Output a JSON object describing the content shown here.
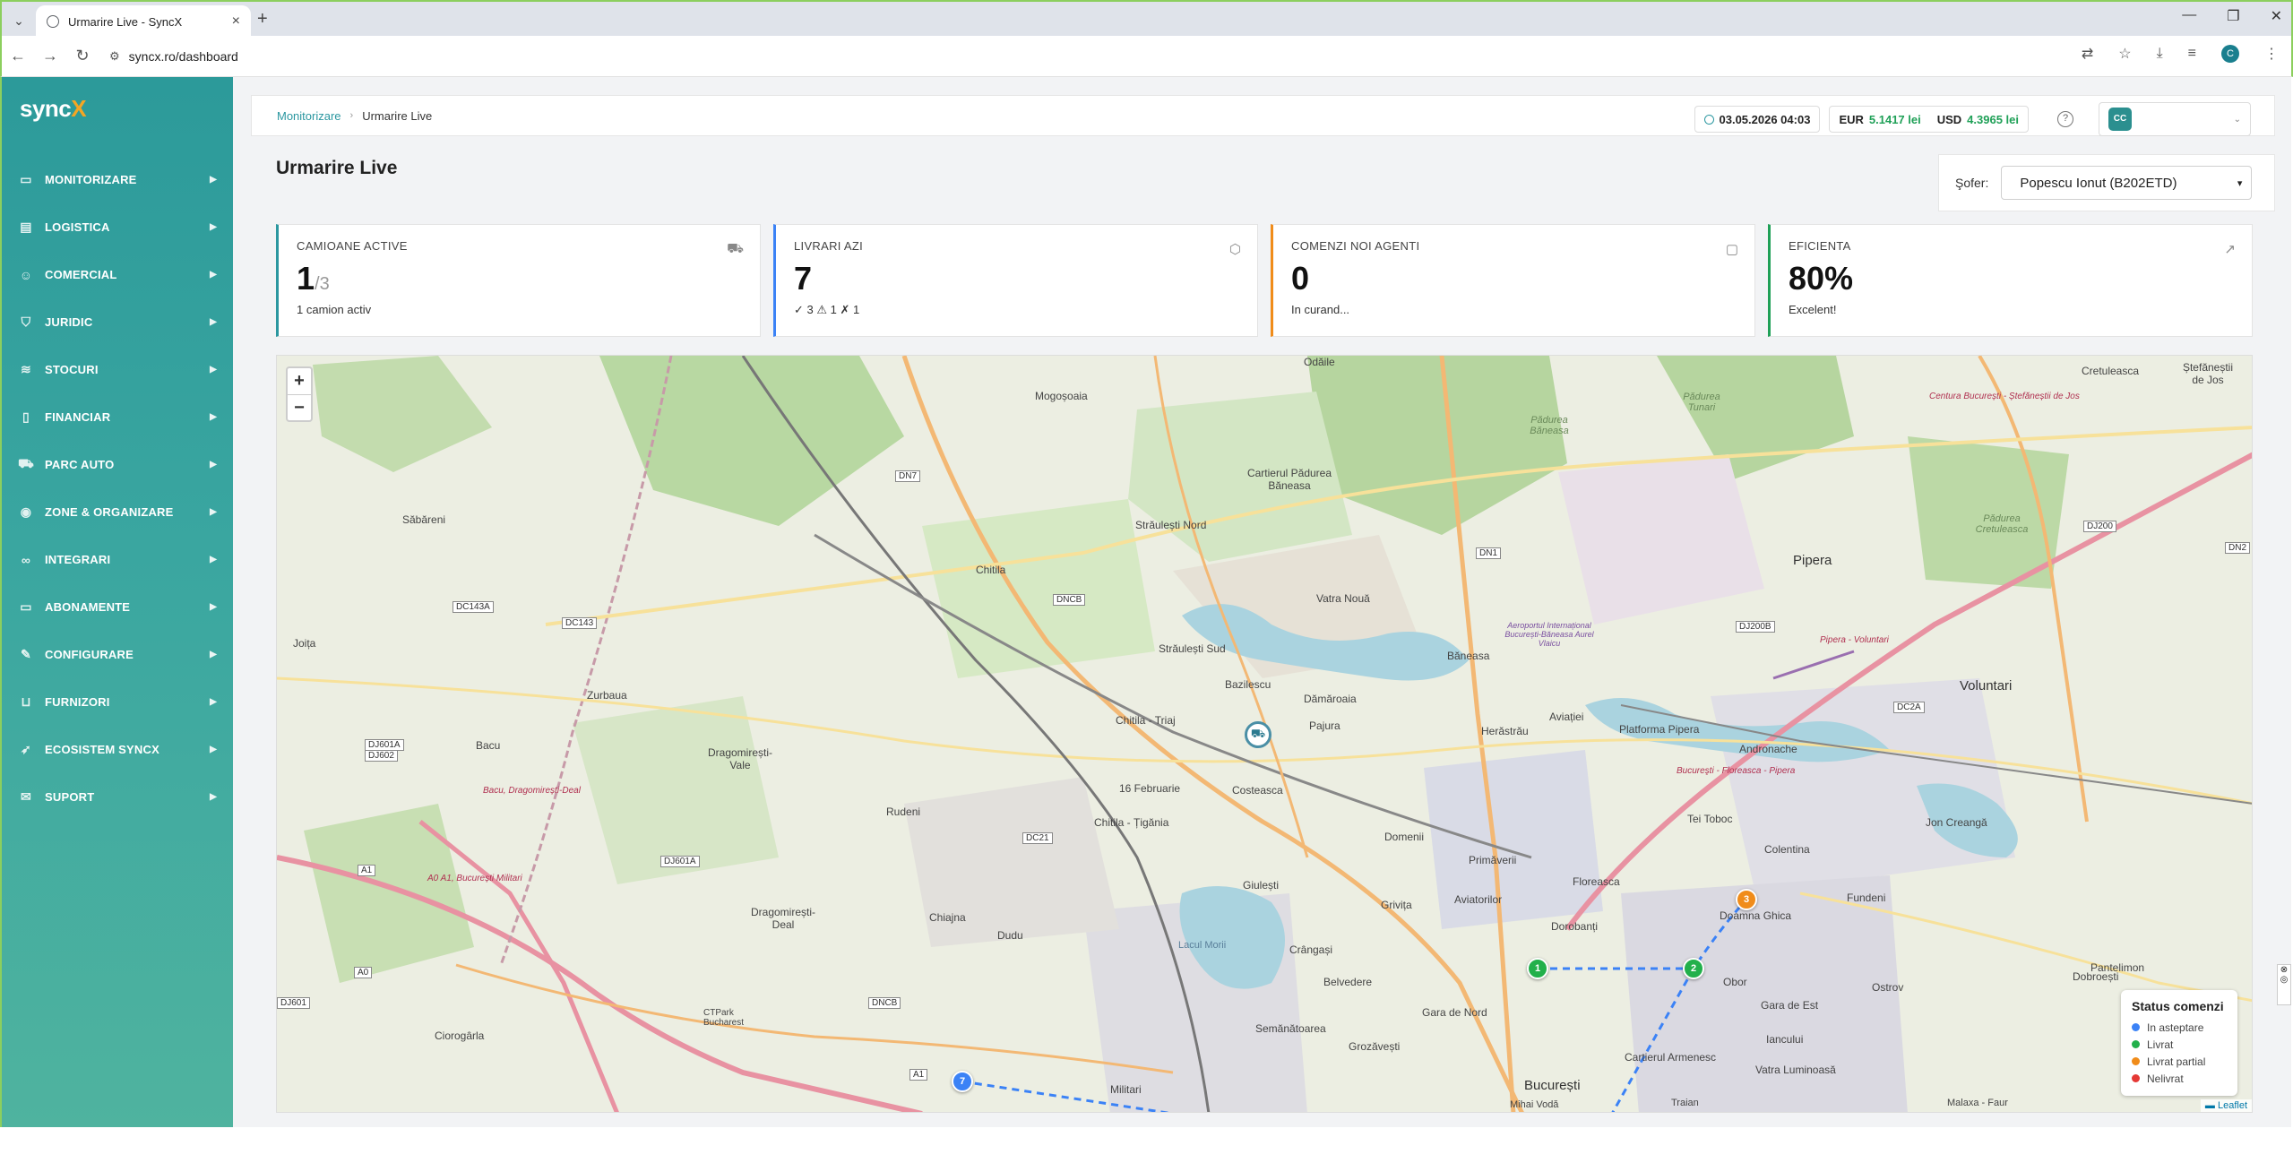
{
  "browser": {
    "tab_title": "Urmarire Live - SyncX",
    "url": "syncx.ro/dashboard",
    "profile_initial": "C"
  },
  "brand": {
    "logo_main": "sync",
    "logo_x": "X"
  },
  "sidebar": {
    "items": [
      {
        "label": "MONITORIZARE",
        "icon": "monitor-icon"
      },
      {
        "label": "LOGISTICA",
        "icon": "clipboard-icon"
      },
      {
        "label": "COMERCIAL",
        "icon": "users-icon"
      },
      {
        "label": "JURIDIC",
        "icon": "shield-icon"
      },
      {
        "label": "STOCURI",
        "icon": "layers-icon"
      },
      {
        "label": "FINANCIAR",
        "icon": "document-icon"
      },
      {
        "label": "PARC AUTO",
        "icon": "truck-icon"
      },
      {
        "label": "ZONE & ORGANIZARE",
        "icon": "map-pin-icon"
      },
      {
        "label": "INTEGRARI",
        "icon": "link-icon"
      },
      {
        "label": "ABONAMENTE",
        "icon": "credit-card-icon"
      },
      {
        "label": "CONFIGURARE",
        "icon": "wrench-icon"
      },
      {
        "label": "FURNIZORI",
        "icon": "cart-icon"
      },
      {
        "label": "ECOSISTEM SYNCX",
        "icon": "rocket-icon"
      },
      {
        "label": "SUPORT",
        "icon": "mail-icon"
      }
    ]
  },
  "header": {
    "breadcrumb_root": "Monitorizare",
    "breadcrumb_current": "Urmarire Live",
    "datetime": "03.05.2026 04:03",
    "eur_label": "EUR",
    "eur_value": "5.1417 lei",
    "usd_label": "USD",
    "usd_value": "4.3965 lei",
    "user_initials": "CC"
  },
  "page": {
    "title": "Urmarire Live",
    "driver_label": "Şofer:",
    "driver_value": "Popescu Ionut (B202ETD)"
  },
  "cards": [
    {
      "title": "CAMIOANE ACTIVE",
      "value": "1",
      "value_sub": "/3",
      "foot": "1 camion activ",
      "accent": "#2b97a0",
      "icon": "truck-icon"
    },
    {
      "title": "LIVRARI AZI",
      "value": "7",
      "value_sub": "",
      "foot": "✓ 3   ⚠ 1   ✗ 1",
      "accent": "#3b82f6",
      "icon": "box-icon"
    },
    {
      "title": "COMENZI NOI AGENTI",
      "value": "0",
      "value_sub": "",
      "foot": "In curand...",
      "accent": "#f08c1a",
      "icon": "basket-icon"
    },
    {
      "title": "EFICIENTA",
      "value": "80%",
      "value_sub": "",
      "foot": "Excelent!",
      "accent": "#1fa057",
      "icon": "trend-up-icon"
    }
  ],
  "map": {
    "zoom_in": "+",
    "zoom_out": "−",
    "attribution": "Leaflet",
    "places": {
      "odaile": "Odăile",
      "mogosoaia": "Mogoșoaia",
      "straulesti_nord": "Străulești Nord",
      "cartierul_padurea_baneasa": "Cartierul Pădurea Băneasa",
      "chitila": "Chitila",
      "vatra_noua": "Vatra Nouă",
      "straulesti_sud": "Străulești Sud",
      "baneasa": "Băneasa",
      "pipera": "Pipera",
      "bazilescu": "Bazilescu",
      "damaroaia": "Dămăroaia",
      "pajura": "Pajura",
      "chitila_triaj": "Chitila - Triaj",
      "herastrau": "Herăstrău",
      "aviatiei": "Aviației",
      "platforma_pipera": "Platforma Pipera",
      "andronache": "Andronache",
      "voluntari": "Voluntari",
      "sabareni": "Săbăreni",
      "joita": "Joița",
      "zurbaua": "Zurbaua",
      "bacu": "Bacu",
      "dragomiresti_vale": "Dragomirești-Vale",
      "rudeni": "Rudeni",
      "16_februarie": "16 Februarie",
      "costeasca": "Costeasca",
      "chitila_tiganie": "Chitila - Țigănia",
      "domenii": "Domenii",
      "tei_toboc": "Tei Toboc",
      "colentina": "Colentina",
      "jon_creanga": "Jon Creangă",
      "primaverii": "Primăverii",
      "floreasca": "Floreasca",
      "giulesti": "Giulești",
      "dragomiresti_deal": "Dragomirești-Deal",
      "chiajna": "Chiajna",
      "dudu": "Dudu",
      "grivita": "Grivița",
      "aviatorilor": "Aviatorilor",
      "dorobanti": "Dorobanți",
      "doamna_ghica": "Doamna Ghica",
      "fundeni": "Fundeni",
      "pantelimon": "Pantelimon",
      "crangasi": "Crângași",
      "belvedere": "Belvedere",
      "gara_de_nord": "Gara de Nord",
      "obor": "Obor",
      "gara_de_est": "Gara de Est",
      "ostrov": "Ostrov",
      "dobroesti": "Dobroești",
      "ciorogarla": "Ciorogârla",
      "semanatoarea": "Semănătoarea",
      "grozavesti": "Grozăvești",
      "iancului": "Iancului",
      "militari": "Militari",
      "cartierul_armenesc": "Cartierul Armenesc",
      "vatra_luminoasa": "Vatra Luminoasă",
      "bucuresti": "București",
      "cretuleasca": "Cretuleasca",
      "stefanestii_de_jos": "Ștefăneștii de Jos",
      "lacul_morii": "Lacul Morii",
      "ctpark": "CTPark Bucharest",
      "padurea_baneasa": "Pădurea Băneasa",
      "padurea_tunari": "Pădurea Tunari",
      "padurea_cretuleasca": "Pădurea Cretuleasca",
      "aeroport": "Aeroportul Internațional București-Băneasa Aurel Vlaicu",
      "centura_1": "Centura București - Ștefăneștii de Jos",
      "pipera_voluntari": "Pipera - Voluntari",
      "bucuresti_floreasca": "Bucureşti - Floreasca - Pipera",
      "bacu_dragomiresti": "Bacu, Dragomirești-Deal",
      "a0": "A0 A1, București Militari",
      "mihai_voda": "Mihai Vodă",
      "traian": "Traian",
      "malaxa": "Malaxa - Faur"
    },
    "roads": {
      "dn7": "DN7",
      "dncb": "DNCB",
      "dn1": "DN1",
      "dj200b": "DJ200B",
      "dj200": "DJ200",
      "dn2": "DN2",
      "dc2a": "DC2A",
      "dc143a": "DC143A",
      "dc143": "DC143",
      "dj601a": "DJ601A",
      "dj602": "DJ602",
      "dj601a2": "DJ601A",
      "dc21": "DC21",
      "dncb2": "DNCB",
      "a1": "A1",
      "a1b": "A1",
      "a0": "A0",
      "dj601": "DJ601"
    },
    "markers": [
      {
        "label": "1",
        "color": "#22b04b"
      },
      {
        "label": "2",
        "color": "#22b04b"
      },
      {
        "label": "3",
        "color": "#f08c1a"
      },
      {
        "label": "7",
        "color": "#3b82f6"
      }
    ],
    "truck_icon": "truck-marker-icon",
    "legend": {
      "title": "Status comenzi",
      "items": [
        {
          "label": "In asteptare",
          "color": "#3b82f6"
        },
        {
          "label": "Livrat",
          "color": "#22b04b"
        },
        {
          "label": "Livrat partial",
          "color": "#f08c1a"
        },
        {
          "label": "Nelivrat",
          "color": "#e53935"
        }
      ]
    }
  }
}
